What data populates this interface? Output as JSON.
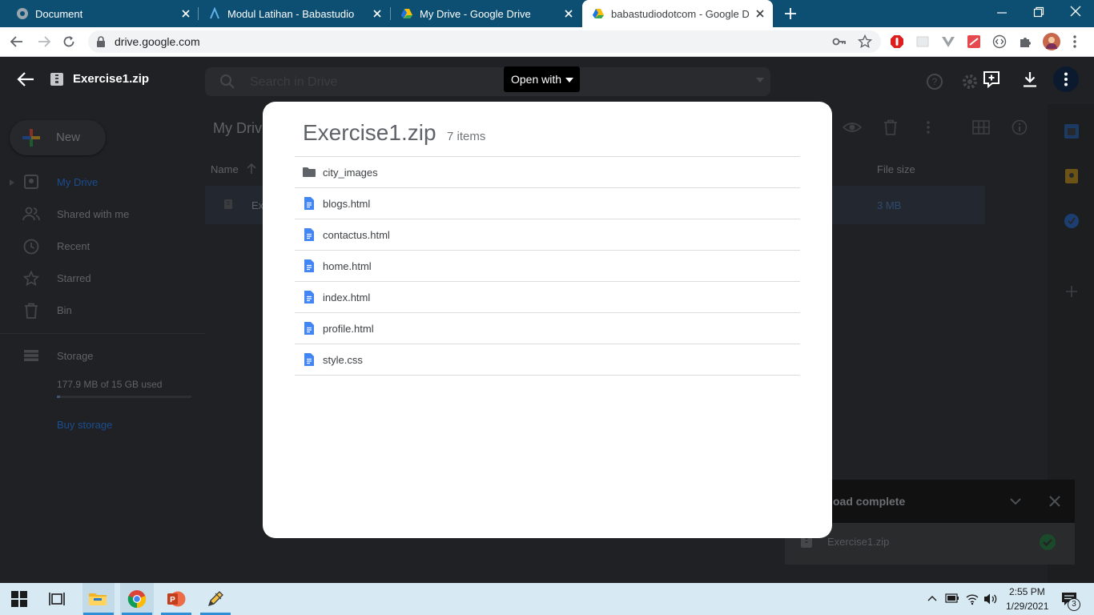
{
  "browser": {
    "tabs": [
      {
        "title": "Document",
        "active": false
      },
      {
        "title": "Modul Latihan - Babastudio",
        "active": false
      },
      {
        "title": "My Drive - Google Drive",
        "active": false
      },
      {
        "title": "babastudiodotcom - Google Driv",
        "active": true
      }
    ],
    "url": "drive.google.com"
  },
  "viewer": {
    "file_name": "Exercise1.zip",
    "open_with_label": "Open with"
  },
  "drive_bg": {
    "new_label": "New",
    "search_placeholder": "Search in Drive",
    "breadcrumb": "My Driv",
    "col_name": "Name",
    "col_size": "File size",
    "row_name": "Ex",
    "row_size": "3 MB",
    "nav": [
      "My Drive",
      "Shared with me",
      "Recent",
      "Starred",
      "Bin"
    ],
    "storage_label": "Storage",
    "storage_used": "177.9 MB of 15 GB used",
    "buy_storage": "Buy storage"
  },
  "dialog": {
    "title": "Exercise1.zip",
    "count": "7 items",
    "items": [
      {
        "name": "city_images",
        "type": "folder"
      },
      {
        "name": "blogs.html",
        "type": "doc"
      },
      {
        "name": "contactus.html",
        "type": "doc"
      },
      {
        "name": "home.html",
        "type": "doc"
      },
      {
        "name": "index.html",
        "type": "doc"
      },
      {
        "name": "profile.html",
        "type": "doc"
      },
      {
        "name": "style.css",
        "type": "doc"
      }
    ]
  },
  "toast": {
    "title": "oad complete",
    "file": "Exercise1.zip"
  },
  "taskbar": {
    "time": "2:55 PM",
    "date": "1/29/2021",
    "notifications": "3"
  },
  "colors": {
    "tabstrip": "#0d4f73",
    "doc_icon": "#4285f4",
    "folder_icon": "#5f6368",
    "check": "#1e8e3e"
  }
}
